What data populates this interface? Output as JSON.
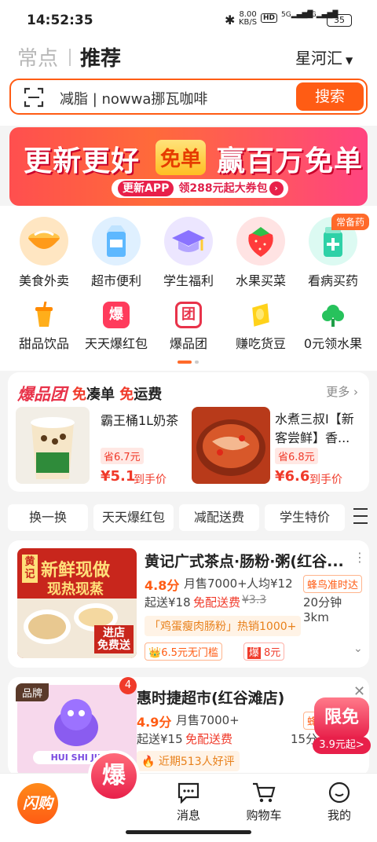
{
  "status": {
    "time": "14:52:35",
    "speed": "8.00",
    "speed_unit": "KB/S",
    "battery": "35",
    "net1": "5G",
    "net2": "5G",
    "hd": "HD"
  },
  "header": {
    "tab_inactive": "常点",
    "tab_active": "推荐",
    "location": "星河汇"
  },
  "search": {
    "placeholder": "减脂 | nowwa挪瓦咖啡",
    "button": "搜索"
  },
  "banner": {
    "t1": "更新更好",
    "t2": "免单",
    "t3": "赢百万",
    "t4": "免单",
    "sub_app": "更新APP",
    "sub_text": "领288元起大券包"
  },
  "categories_row1": [
    {
      "label": "美食外卖",
      "icon": "noodle-bowl-icon"
    },
    {
      "label": "超市便利",
      "icon": "milk-carton-icon"
    },
    {
      "label": "学生福利",
      "icon": "graduation-cap-icon"
    },
    {
      "label": "水果买菜",
      "icon": "strawberry-icon"
    },
    {
      "label": "看病买药",
      "icon": "medicine-icon",
      "badge": "常备药"
    }
  ],
  "categories_row2": [
    {
      "label": "甜品饮品",
      "icon": "drink-cup-icon"
    },
    {
      "label": "天天爆红包",
      "icon": "red-packet-icon",
      "glyph": "爆"
    },
    {
      "label": "爆品团",
      "icon": "group-icon",
      "glyph": "团"
    },
    {
      "label": "赚吃货豆",
      "icon": "bean-icon"
    },
    {
      "label": "0元领水果",
      "icon": "tree-icon"
    }
  ],
  "promo": {
    "brand": "爆品团",
    "slogan1": "免",
    "slogan2": "凑单 ",
    "slogan3": "免",
    "slogan4": "运费",
    "more": "更多",
    "items": [
      {
        "name": "霸王桶1L奶茶",
        "save": "省6.7元",
        "price": "¥5.1",
        "suffix": "到手价"
      },
      {
        "name": "水煮三叔I【新客尝鲜】香...",
        "save": "省6.8元",
        "price": "¥6.6",
        "suffix": "到手价"
      }
    ]
  },
  "filters": [
    "换一换",
    "天天爆红包",
    "减配送费",
    "学生特价"
  ],
  "stores": [
    {
      "name": "黄记广式茶点·肠粉·粥(红谷...",
      "rating": "4.8分",
      "sales": "月售7000+",
      "avg": "人均¥12",
      "delivery_tag": "蜂鸟准时达",
      "min": "起送¥18",
      "fee": "免配送费",
      "old_fee": "¥3.3",
      "time": "20分钟 3km",
      "hot": "「鸡蛋瘦肉肠粉」热销1000+",
      "coupon1": "6.5元无门槛",
      "coupon2_tag": "爆",
      "coupon2": "8元",
      "img_text1": "新鲜现做",
      "img_text2": "现热现蒸",
      "img_badge": "进店\n免费送",
      "img_brand": "黄记"
    },
    {
      "name": "惠时捷超市(红谷滩店)",
      "rating": "4.9分",
      "sales": "月售7000+",
      "delivery_tag": "蜂",
      "min": "起送¥15",
      "fee": "免配送费",
      "time": "15分",
      "review": "近期513人好评",
      "brand_tag": "品牌",
      "badge_count": "4",
      "img_text": "HUI SHI JIE",
      "float1": "限免",
      "float2": "3.9元起>"
    }
  ],
  "nav": {
    "flash": "闪购",
    "bao": "爆",
    "msg": "消息",
    "cart": "购物车",
    "me": "我的"
  }
}
